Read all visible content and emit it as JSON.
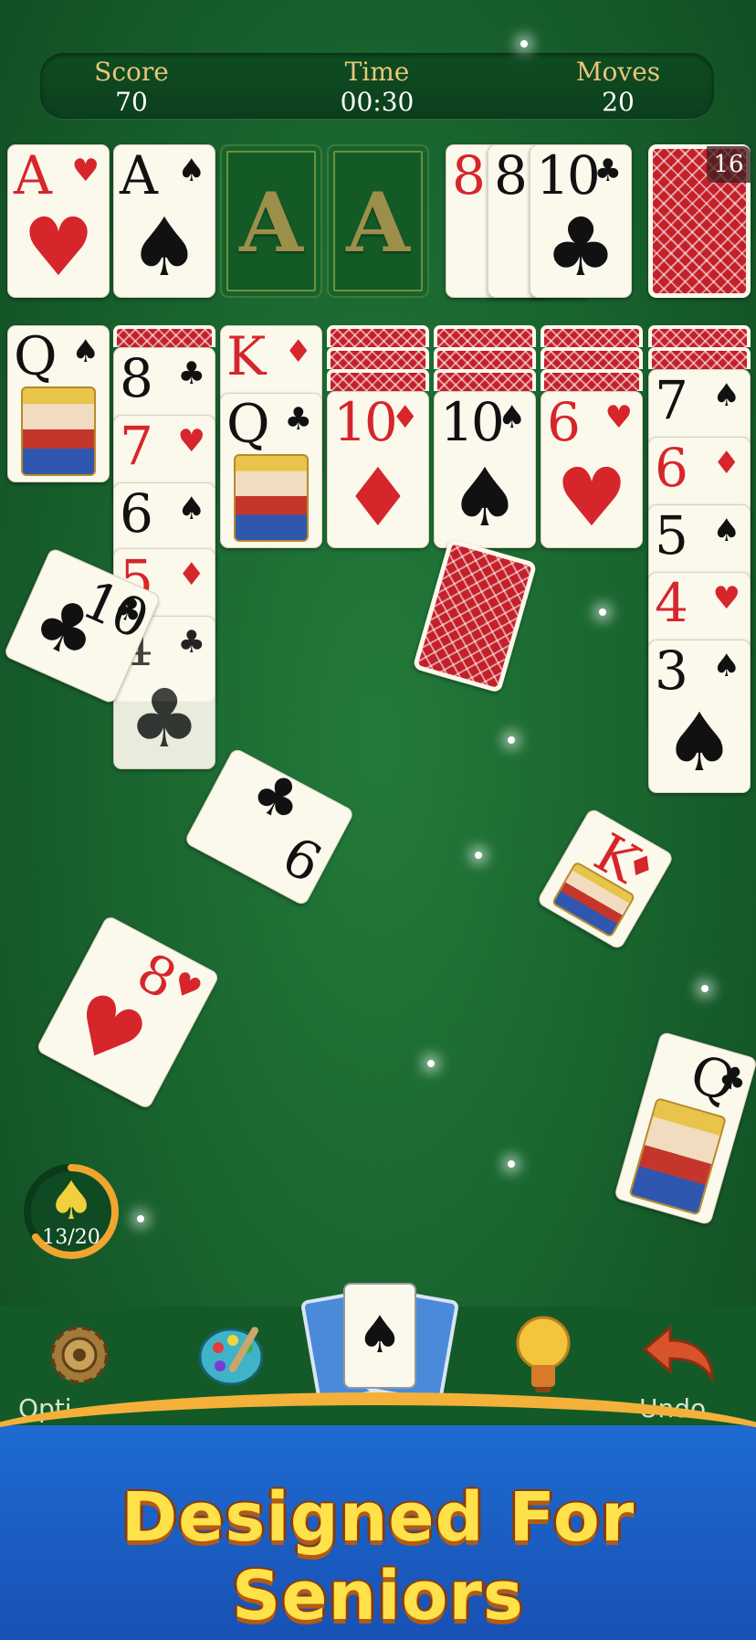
{
  "hud": {
    "score_label": "Score",
    "score_value": "70",
    "time_label": "Time",
    "time_value": "00:30",
    "moves_label": "Moves",
    "moves_value": "20"
  },
  "stock": {
    "count": "16"
  },
  "foundations": [
    {
      "rank": "A",
      "suit": "♥"
    },
    {
      "rank": "A",
      "suit": "♠"
    },
    {
      "placeholder": "A"
    },
    {
      "placeholder": "A"
    }
  ],
  "waste": [
    {
      "rank": "8",
      "suit": "♦"
    },
    {
      "rank": "8",
      "suit": "♠"
    },
    {
      "rank": "10",
      "suit": "♣"
    }
  ],
  "tableau": {
    "col1": [
      {
        "rank": "Q",
        "suit": "♠"
      }
    ],
    "col2": [
      {
        "rank": "8",
        "suit": "♣"
      },
      {
        "rank": "7",
        "suit": "♥"
      },
      {
        "rank": "6",
        "suit": "♠"
      },
      {
        "rank": "5",
        "suit": "♦"
      },
      {
        "rank": "4",
        "suit": "♣"
      }
    ],
    "col3": [
      {
        "rank": "K",
        "suit": "♦"
      },
      {
        "rank": "Q",
        "suit": "♣"
      }
    ],
    "col4": [
      {
        "rank": "10",
        "suit": "♦"
      }
    ],
    "col5": [
      {
        "rank": "10",
        "suit": "♠"
      }
    ],
    "col6": [
      {
        "rank": "6",
        "suit": "♥"
      }
    ],
    "col7": [
      {
        "rank": "7",
        "suit": "♠"
      },
      {
        "rank": "6",
        "suit": "♦"
      },
      {
        "rank": "5",
        "suit": "♠"
      },
      {
        "rank": "4",
        "suit": "♥"
      },
      {
        "rank": "3",
        "suit": "♠"
      }
    ]
  },
  "flying_cards": [
    {
      "rank": "10",
      "suit": "♣"
    },
    {
      "rank": "6",
      "suit": "♣"
    },
    {
      "rank": "8",
      "suit": "♥"
    },
    {
      "rank": "K",
      "suit": "♦"
    },
    {
      "rank": "Q",
      "suit": "♣"
    }
  ],
  "progress": {
    "label": "13/20",
    "fraction": 0.65,
    "icon": "spade-icon"
  },
  "toolbar": {
    "options_label": "Opti",
    "undo_label": "Undo",
    "items": [
      "gear-icon",
      "palette-icon",
      "deck-icon",
      "lightbulb-icon",
      "undo-arrow-icon"
    ]
  },
  "banner": {
    "text": "Designed For Seniors"
  },
  "colors": {
    "felt": "#1a6630",
    "card_back": "#c4202a",
    "gold": "#f3b13a",
    "banner_blue": "#1e6bd0",
    "red_suit": "#d6262b"
  }
}
